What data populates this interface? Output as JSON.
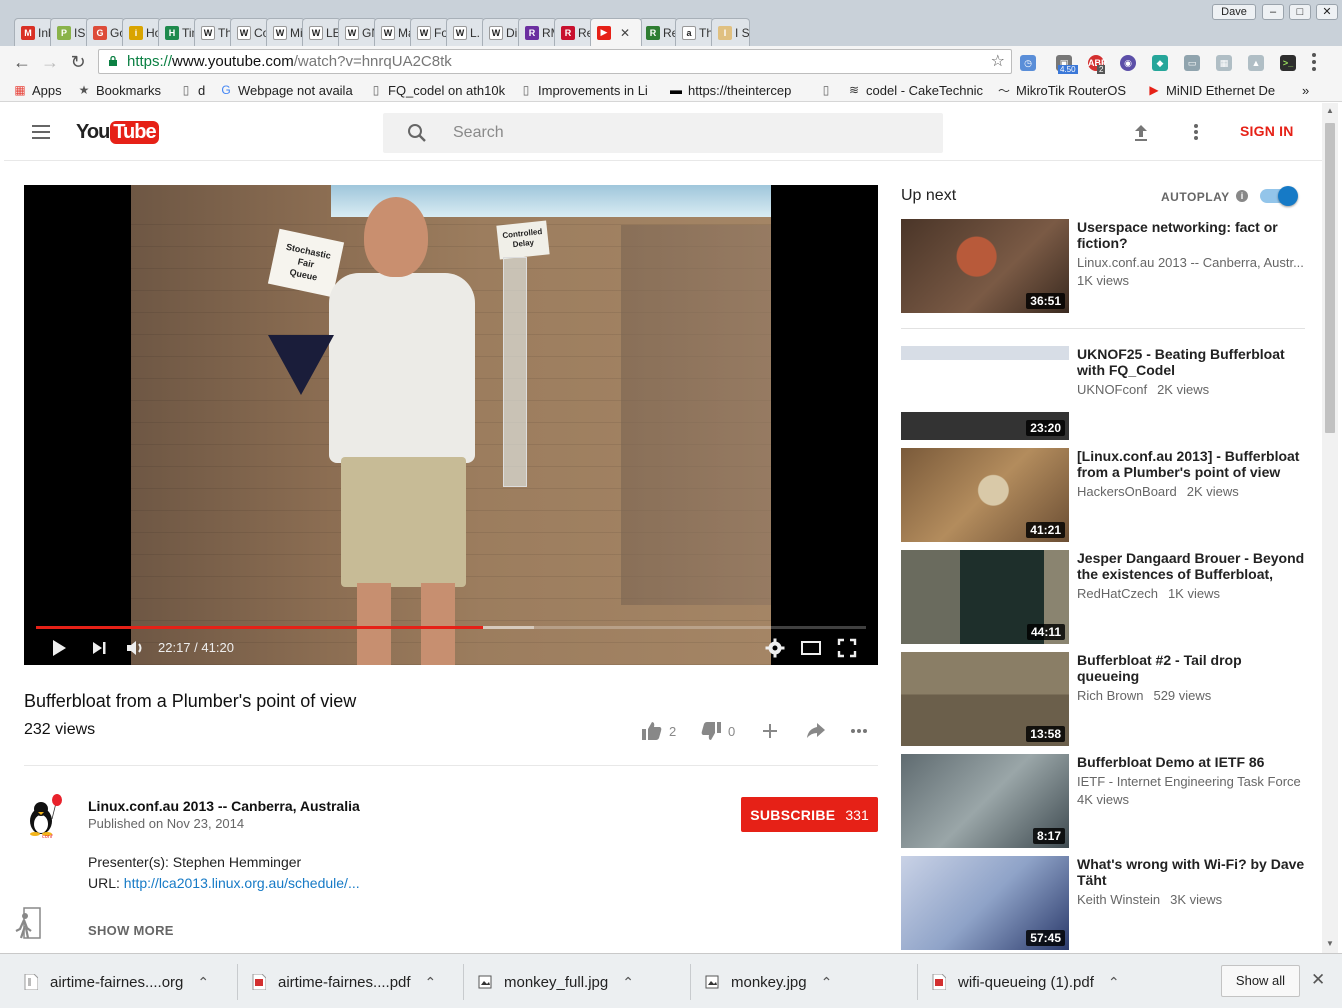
{
  "browser": {
    "tabs": [
      {
        "label": "Inb",
        "icon": "gmail-icon",
        "color": "#d93025",
        "glyph": "M"
      },
      {
        "label": "ISP",
        "icon": "puzzle-icon",
        "color": "#8ab34a",
        "glyph": "P"
      },
      {
        "label": "Goo",
        "icon": "google-plus-icon",
        "color": "#dd4b39",
        "glyph": "G"
      },
      {
        "label": "How",
        "icon": "bulb-icon",
        "color": "#d9a400",
        "glyph": "i"
      },
      {
        "label": "Tiny",
        "icon": "h-icon",
        "color": "#1e8a4d",
        "glyph": "H"
      },
      {
        "label": "The",
        "icon": "wikipedia-icon",
        "color": "#ffffff",
        "glyph": "W"
      },
      {
        "label": "Coll",
        "icon": "wikipedia-icon",
        "color": "#ffffff",
        "glyph": "W"
      },
      {
        "label": "Min",
        "icon": "wikipedia-icon",
        "color": "#ffffff",
        "glyph": "W"
      },
      {
        "label": "LEM",
        "icon": "wikipedia-icon",
        "color": "#ffffff",
        "glyph": "W"
      },
      {
        "label": "GN",
        "icon": "wikipedia-icon",
        "color": "#ffffff",
        "glyph": "W"
      },
      {
        "label": "Ma",
        "icon": "wikipedia-icon",
        "color": "#ffffff",
        "glyph": "W"
      },
      {
        "label": "For",
        "icon": "wikipedia-icon",
        "color": "#ffffff",
        "glyph": "W"
      },
      {
        "label": "L. R",
        "icon": "wikipedia-icon",
        "color": "#ffffff",
        "glyph": "W"
      },
      {
        "label": "Din",
        "icon": "wikipedia-icon",
        "color": "#ffffff",
        "glyph": "W"
      },
      {
        "label": "RM",
        "icon": "rand-icon",
        "color": "#6b2fa0",
        "glyph": "R"
      },
      {
        "label": "Rea",
        "icon": "rcp-icon",
        "color": "#c8102e",
        "glyph": "R"
      },
      {
        "label": "",
        "icon": "youtube-icon",
        "color": "#e62117",
        "glyph": "▶",
        "active": true
      },
      {
        "label": "Rea",
        "icon": "rcm-icon",
        "color": "#2e7d32",
        "glyph": "R"
      },
      {
        "label": "Tha",
        "icon": "amazon-icon",
        "color": "#ffffff",
        "glyph": "a"
      },
      {
        "label": "I So",
        "icon": "page-icon",
        "color": "#e0c080",
        "glyph": "I"
      }
    ],
    "profile_name": "Dave",
    "url_protocol": "https://",
    "url_host": "www.youtube.com",
    "url_path": "/watch?v=hnrqUA2C8tk",
    "ext_badge_1": "4.50",
    "ext_badge_2": "2",
    "bookmarks": [
      {
        "label": "Apps",
        "icon": "apps-grid-icon"
      },
      {
        "label": "Bookmarks",
        "icon": "star-icon"
      },
      {
        "label": "d",
        "icon": "page-icon"
      },
      {
        "label": "Webpage not availa",
        "icon": "google-icon"
      },
      {
        "label": "FQ_codel on ath10k",
        "icon": "page-icon"
      },
      {
        "label": "Improvements in Li",
        "icon": "page-icon"
      },
      {
        "label": "https://theintercep",
        "icon": "intercept-icon"
      },
      {
        "label": "",
        "icon": "page-icon"
      },
      {
        "label": "codel - CakeTechnic",
        "icon": "cake-icon"
      },
      {
        "label": "MikroTik RouterOS",
        "icon": "mikrotik-icon"
      },
      {
        "label": "MiNID Ethernet De",
        "icon": "youtube-icon"
      }
    ]
  },
  "youtube": {
    "search_placeholder": "Search",
    "signin_label": "SIGN IN",
    "player": {
      "time_current": "22:17",
      "time_total": "41:20",
      "progress_fraction": 0.539,
      "buffered_fraction": 0.6
    },
    "video": {
      "title": "Bufferbloat from a Plumber's point of view",
      "views": "232 views",
      "likes": "2",
      "dislikes": "0"
    },
    "channel": {
      "name": "Linux.conf.au 2013 -- Canberra, Australia",
      "published": "Published on Nov 23, 2014",
      "subscribe_label": "SUBSCRIBE",
      "subscriber_count": "331"
    },
    "description": {
      "presenters": "Presenter(s): Stephen Hemminger",
      "url_label": "URL: ",
      "url_link": "http://lca2013.linux.org.au/schedule/...",
      "show_more": "SHOW MORE"
    },
    "up_next": {
      "label": "Up next",
      "autoplay_label": "AUTOPLAY",
      "autoplay_info": "i",
      "autoplay_on": true
    },
    "recommendations": [
      {
        "title": "Userspace networking: fact or fiction?",
        "channel": "Linux.conf.au 2013 -- Canberra, Austr...",
        "views": "1K views",
        "duration": "36:51",
        "views_on_own_line": true
      },
      {
        "title": "UKNOF25 - Beating Bufferbloat with FQ_Codel",
        "channel": "UKNOFconf",
        "views": "2K views",
        "duration": "23:20"
      },
      {
        "title": "[Linux.conf.au 2013] - Bufferbloat from a Plumber's point of view",
        "channel": "HackersOnBoard",
        "views": "2K views",
        "duration": "41:21"
      },
      {
        "title": "Jesper Dangaard Brouer - Beyond the existences of Bufferbloat, have",
        "channel": "RedHatCzech",
        "views": "1K views",
        "duration": "44:11"
      },
      {
        "title": "Bufferbloat #2 - Tail drop queueing",
        "channel": "Rich Brown",
        "views": "529 views",
        "duration": "13:58"
      },
      {
        "title": "Bufferbloat Demo at IETF 86",
        "channel": "IETF - Internet Engineering Task Force",
        "views": "4K views",
        "duration": "8:17",
        "views_on_own_line": true
      },
      {
        "title": "What's wrong with Wi-Fi? by Dave Täht",
        "channel": "Keith Winstein",
        "views": "3K views",
        "duration": "57:45"
      }
    ]
  },
  "downloads": {
    "items": [
      {
        "name": "airtime-fairnes....org",
        "icon": "file-icon"
      },
      {
        "name": "airtime-fairnes....pdf",
        "icon": "pdf-icon"
      },
      {
        "name": "monkey_full.jpg",
        "icon": "image-icon"
      },
      {
        "name": "monkey.jpg",
        "icon": "image-icon"
      },
      {
        "name": "wifi-queueing (1).pdf",
        "icon": "pdf-icon"
      }
    ],
    "show_all_label": "Show all"
  },
  "colors": {
    "youtube_red": "#e62117",
    "link_blue": "#167ac6",
    "toggle_blue": "#167ac6"
  }
}
